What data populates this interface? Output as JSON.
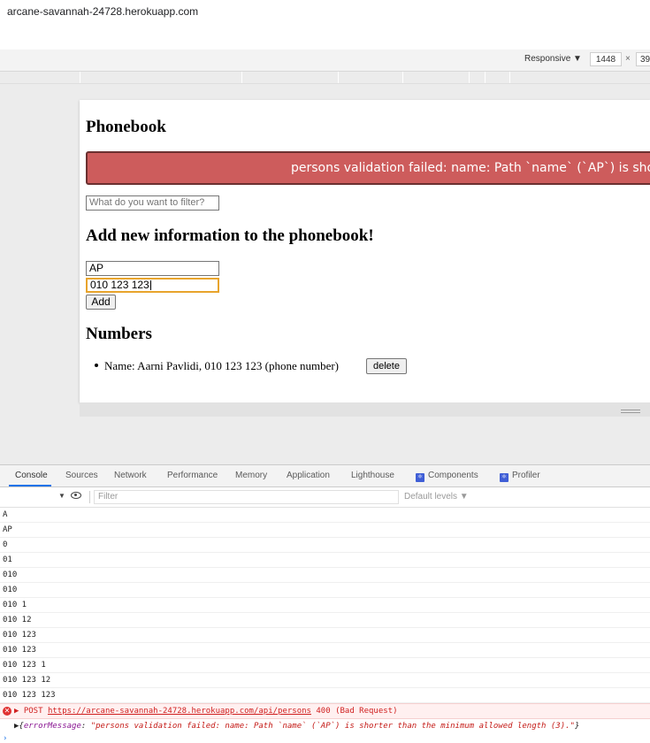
{
  "browser": {
    "url": "arcane-savannah-24728.herokuapp.com"
  },
  "device_toolbar": {
    "mode": "Responsive ▼",
    "width": "1448",
    "times": "×",
    "height": "39"
  },
  "app": {
    "title": "Phonebook",
    "error_message": "persons validation failed: name: Path `name` (`AP`) is shorter than the minimum allowed length (3).",
    "filter_placeholder": "What do you want to filter?",
    "add_heading": "Add new information to the phonebook!",
    "name_value": "AP",
    "number_value": "010 123 123",
    "add_label": "Add",
    "numbers_heading": "Numbers",
    "entries": [
      {
        "text": "Name: Aarni Pavlidi, 010 123 123 (phone number)",
        "delete_label": "delete"
      }
    ]
  },
  "devtools": {
    "tabs": [
      "Console",
      "Sources",
      "Network",
      "Performance",
      "Memory",
      "Application",
      "Lighthouse",
      "Components",
      "Profiler"
    ],
    "active_tab": "Console",
    "filter_placeholder": "Filter",
    "levels": "Default levels ▼",
    "log_lines": [
      "A",
      "AP",
      "0",
      "01",
      "010",
      "010",
      "010 1",
      "010 12",
      "010 123",
      "010 123",
      "010 123 1",
      "010 123 12",
      "010 123 123"
    ],
    "error": {
      "method": "POST",
      "url": "https://arcane-savannah-24728.herokuapp.com/api/persons",
      "status": "400 (Bad Request)"
    },
    "object": {
      "key": "errorMessage",
      "value": "\"persons validation failed: name: Path `name` (`AP`) is shorter than the minimum allowed length (3).\""
    }
  },
  "colors": {
    "error_banner": "#cd5c5c",
    "focus_ring": "#e8a42c",
    "devtools_accent": "#1a73e8",
    "console_error": "#d02020"
  }
}
